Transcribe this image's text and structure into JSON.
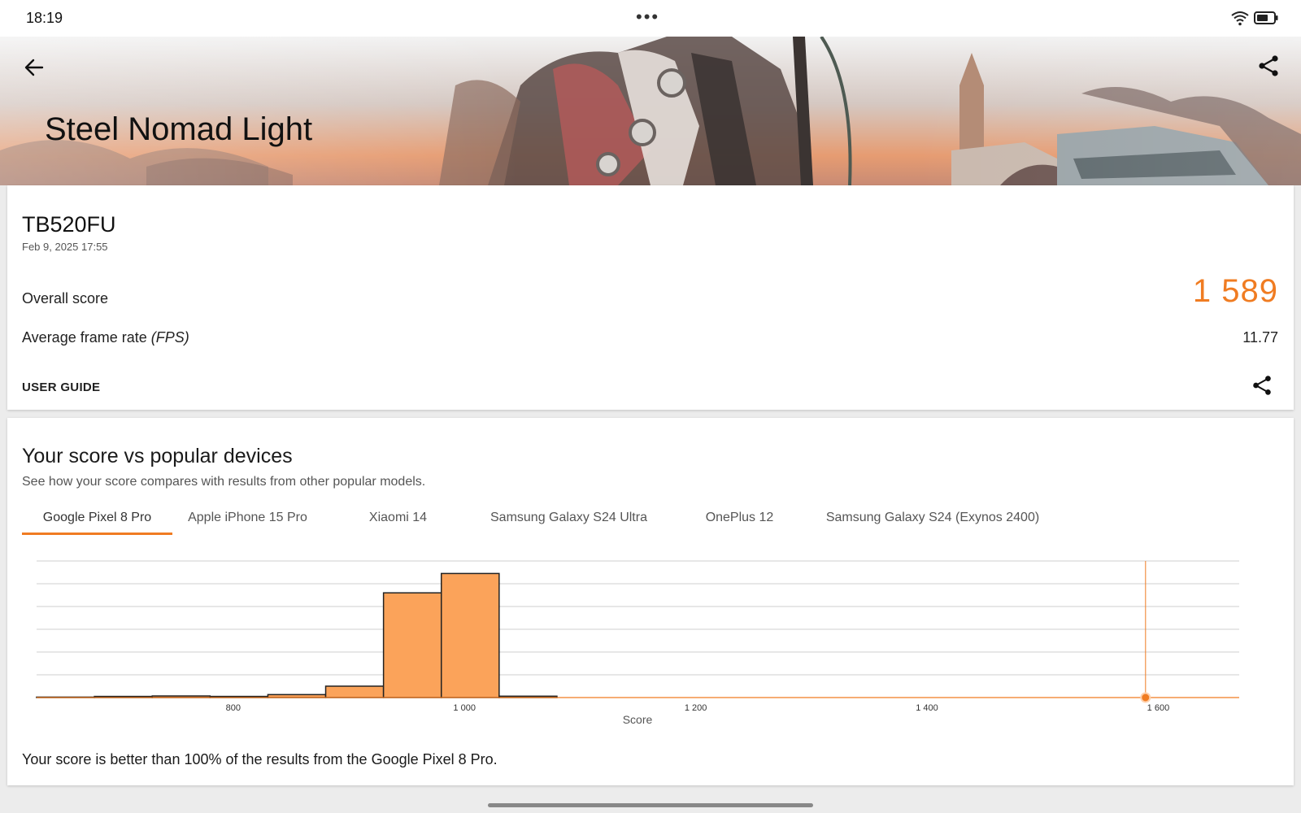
{
  "status_bar": {
    "time": "18:19"
  },
  "hero": {
    "title": "Steel Nomad Light"
  },
  "result": {
    "device": "TB520FU",
    "date": "Feb 9, 2025 17:55",
    "overall_label": "Overall score",
    "overall_value": "1 589",
    "fps_label": "Average frame rate ",
    "fps_unit": "(FPS)",
    "fps_value": "11.77",
    "user_guide": "USER GUIDE"
  },
  "comparison": {
    "title": "Your score vs popular devices",
    "subtitle": "See how your score compares with results from other popular models.",
    "tabs": [
      {
        "label": "Google Pixel 8 Pro",
        "active": true
      },
      {
        "label": "Apple iPhone 15 Pro",
        "active": false
      },
      {
        "label": "Xiaomi 14",
        "active": false
      },
      {
        "label": "Samsung Galaxy S24 Ultra",
        "active": false
      },
      {
        "label": "OnePlus 12",
        "active": false
      },
      {
        "label": "Samsung Galaxy S24 (Exynos 2400)",
        "active": false
      }
    ],
    "verdict": "Your score is better than 100% of the results from the Google Pixel 8 Pro."
  },
  "colors": {
    "accent": "#f07c22",
    "bar_fill": "#fba35a"
  },
  "chart_data": {
    "type": "bar",
    "xlabel": "Score",
    "ylabel": "",
    "xlim": [
      630,
      1670
    ],
    "ylim": [
      0,
      6
    ],
    "grid": true,
    "x_ticks": [
      {
        "value": 800,
        "label": "800"
      },
      {
        "value": 1000,
        "label": "1 000"
      },
      {
        "value": 1200,
        "label": "1 200"
      },
      {
        "value": 1400,
        "label": "1 400"
      },
      {
        "value": 1600,
        "label": "1 600"
      }
    ],
    "bins": [
      {
        "from": 630,
        "to": 680,
        "value": 0.02
      },
      {
        "from": 680,
        "to": 730,
        "value": 0.05
      },
      {
        "from": 730,
        "to": 780,
        "value": 0.07
      },
      {
        "from": 780,
        "to": 830,
        "value": 0.05
      },
      {
        "from": 830,
        "to": 880,
        "value": 0.13
      },
      {
        "from": 880,
        "to": 930,
        "value": 0.5
      },
      {
        "from": 930,
        "to": 980,
        "value": 4.6
      },
      {
        "from": 980,
        "to": 1030,
        "value": 5.45
      },
      {
        "from": 1030,
        "to": 1080,
        "value": 0.06
      }
    ],
    "user_score": 1589
  }
}
